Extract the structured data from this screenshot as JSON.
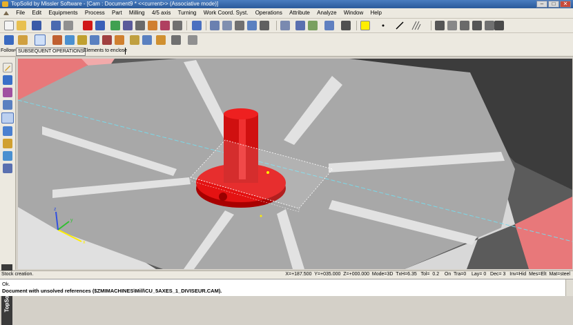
{
  "window": {
    "title": "TopSolid by Missler Software - [Cam : Document9 *  <<current>> (Associative mode)]"
  },
  "menu": [
    "File",
    "Edit",
    "Equipments",
    "Process",
    "Part",
    "Milling",
    "4/5 axis",
    "Turning",
    "Work Coord. Syst.",
    "Operations",
    "Attribute",
    "Analyze",
    "Window",
    "Help"
  ],
  "follow": {
    "label": "Follow=",
    "mode": "SUBSEQUENT OPERATIONS",
    "prompt": "Elements to enclose"
  },
  "brand": "TopSolid · Cam",
  "status": {
    "message": "Stock creation.",
    "readout": "X=+187.500  Y=+035.000  Z=+000.000  Mode=3D  TxH=6.35   Tol=  0.2    On  Tra=0    Lay= 0   Dec= 3   Inv=Hid  Mes=Elt  Mat=steel"
  },
  "messages": {
    "line1": "Ok.",
    "line2": "Document with unsolved references ($ZMIMACHINES\\Mill\\CU_5AXES_1_DIVISEUR.CAM)."
  },
  "colors": {
    "viewport_bg": "#5a5a5a",
    "plate": "#a9a9a9",
    "part": "#dd1010",
    "salmon": "#e8787a",
    "dark": "#3c3c3c"
  }
}
